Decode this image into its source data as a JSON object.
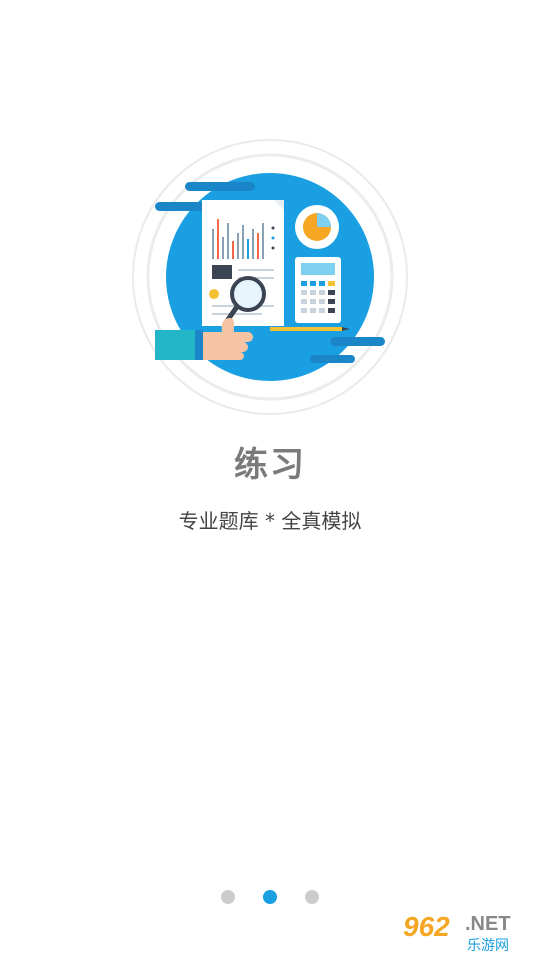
{
  "onboarding": {
    "title": "练习",
    "subtitle": "专业题库 * 全真模拟",
    "page_count": 3,
    "active_page": 2
  },
  "watermark": {
    "logo_number": "962",
    "logo_domain": ".NET",
    "logo_tagline": "乐游网"
  },
  "colors": {
    "accent": "#1a9fe0",
    "inactive_dot": "#cccccc",
    "title": "#7a7a7a",
    "subtitle": "#444444"
  },
  "icons": {
    "hero": "report-analysis-illustration",
    "chart": "bar-chart-icon",
    "pie": "pie-chart-icon",
    "search": "magnifier-icon",
    "calculator": "calculator-icon"
  }
}
